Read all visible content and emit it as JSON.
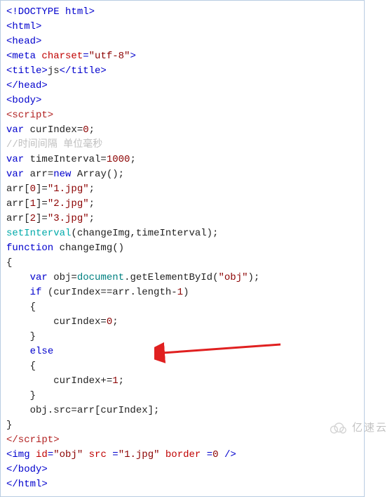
{
  "code": {
    "l1_a": "<!DOCTYPE html>",
    "l2_a": "<html>",
    "l3_a": "<head>",
    "l4_a": "<meta ",
    "l4_b": "charset",
    "l4_c": "=",
    "l4_d": "\"utf-8\"",
    "l4_e": ">",
    "l5_a": "<title>",
    "l5_b": "js",
    "l5_c": "</title>",
    "l6_a": "</head>",
    "l7_a": "<body>",
    "l8_a": "<script>",
    "l9_a": "var",
    "l9_b": " curIndex=",
    "l9_c": "0",
    "l9_d": ";",
    "l10_a": "//时间间隔 单位毫秒",
    "l11_a": "var",
    "l11_b": " timeInterval=",
    "l11_c": "1000",
    "l11_d": ";",
    "l12_a": "var",
    "l12_b": " arr=",
    "l12_c": "new",
    "l12_d": " Array();",
    "l13_a": "arr[",
    "l13_b": "0",
    "l13_c": "]=",
    "l13_d": "\"1.jpg\"",
    "l13_e": ";",
    "l14_a": "arr[",
    "l14_b": "1",
    "l14_c": "]=",
    "l14_d": "\"2.jpg\"",
    "l14_e": ";",
    "l15_a": "arr[",
    "l15_b": "2",
    "l15_c": "]=",
    "l15_d": "\"3.jpg\"",
    "l15_e": ";",
    "l16_a": "setInterval",
    "l16_b": "(changeImg,timeInterval);",
    "l17_a": "function",
    "l17_b": " changeImg()",
    "l18_a": "{",
    "l19_a": "    ",
    "l19_b": "var",
    "l19_c": " obj=",
    "l19_d": "document",
    "l19_e": ".getElementById(",
    "l19_f": "\"obj\"",
    "l19_g": ");",
    "l20_a": "    ",
    "l20_b": "if",
    "l20_c": " (curIndex==arr.length-",
    "l20_d": "1",
    "l20_e": ")",
    "l21_a": "    {",
    "l22_a": "        curIndex=",
    "l22_b": "0",
    "l22_c": ";",
    "l23_a": "    }",
    "l24_a": "    ",
    "l24_b": "else",
    "l25_a": "    {",
    "l26_a": "        curIndex+=",
    "l26_b": "1",
    "l26_c": ";",
    "l27_a": "    }",
    "l28_a": "    obj.src=arr[curIndex];",
    "l29_a": "}",
    "l30_a": "</script>",
    "l31_a": "<img ",
    "l31_b": "id",
    "l31_c": "=",
    "l31_d": "\"obj\"",
    "l31_e": " ",
    "l31_f": "src",
    "l31_g": " =",
    "l31_h": "\"1.jpg\"",
    "l31_i": " ",
    "l31_j": "border",
    "l31_k": " =",
    "l31_l": "0",
    "l31_m": " />",
    "l32_a": "</body>",
    "l33_a": "</html>"
  },
  "watermark": {
    "text": "亿速云"
  }
}
